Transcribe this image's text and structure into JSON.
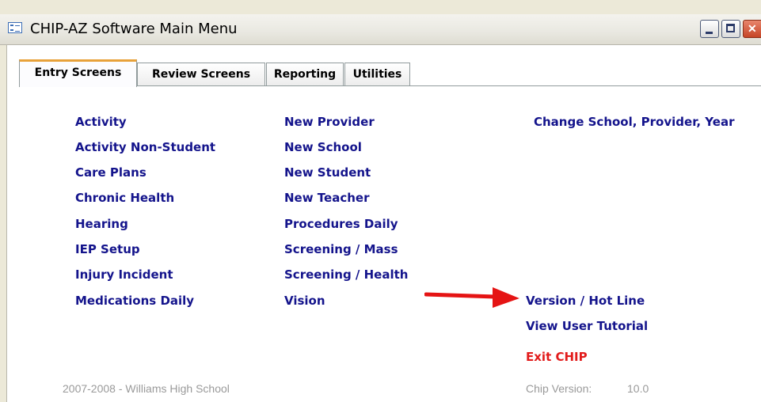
{
  "window": {
    "title": "CHIP-AZ Software Main Menu",
    "icon": "form-window-icon"
  },
  "tabs": [
    {
      "label": "Entry Screens",
      "active": true
    },
    {
      "label": "Review Screens",
      "active": false
    },
    {
      "label": "Reporting",
      "active": false
    },
    {
      "label": "Utilities",
      "active": false
    }
  ],
  "columns": {
    "col1": [
      "Activity",
      "Activity Non-Student",
      "Care Plans",
      "Chronic Health",
      "Hearing",
      "IEP Setup",
      "Injury Incident",
      "Medications Daily"
    ],
    "col2": [
      "New Provider",
      "New School",
      "New Student",
      "New Teacher",
      "Procedures Daily",
      "Screening / Mass",
      "Screening / Health",
      "Vision"
    ],
    "col3_top": "Change School, Provider, Year",
    "col3_bottom": [
      "Version / Hot Line",
      "View User Tutorial"
    ],
    "exit": "Exit CHIP"
  },
  "footer": {
    "school": "2007-2008 - Williams High School",
    "version_label": "Chip Version:",
    "version_value": "10.0"
  },
  "colors": {
    "link": "#14148c",
    "exit": "#e21b1b",
    "arrow": "#e51414",
    "tab_accent": "#e8a23a"
  }
}
